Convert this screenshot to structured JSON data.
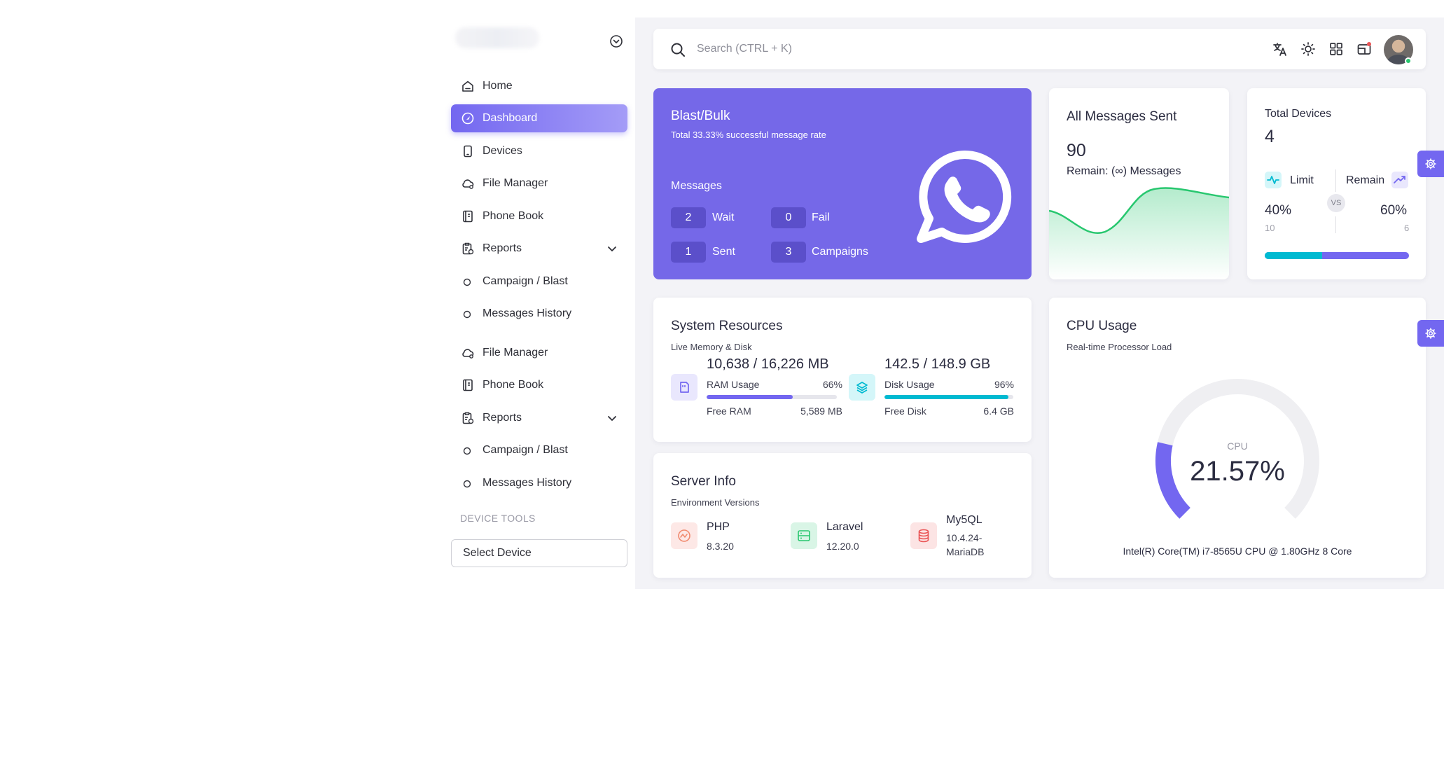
{
  "sidebar": {
    "items": [
      {
        "label": "Home"
      },
      {
        "label": "Dashboard"
      },
      {
        "label": "Devices"
      },
      {
        "label": "File Manager"
      },
      {
        "label": "Phone Book"
      },
      {
        "label": "Reports"
      },
      {
        "label": "Campaign / Blast"
      },
      {
        "label": "Messages History"
      },
      {
        "label": "File Manager"
      },
      {
        "label": "Phone Book"
      },
      {
        "label": "Reports"
      },
      {
        "label": "Campaign / Blast"
      },
      {
        "label": "Messages History"
      }
    ],
    "section_title": "DEVICE TOOLS",
    "select_device": "Select Device"
  },
  "search": {
    "placeholder": "Search (CTRL + K)"
  },
  "blast": {
    "title": "Blast/Bulk",
    "subtitle_prefix": "Total ",
    "rate": "33.33%",
    "subtitle_suffix": " successful message rate",
    "messages_label": "Messages",
    "stats": [
      {
        "value": "2",
        "label": "Wait"
      },
      {
        "value": "0",
        "label": "Fail"
      },
      {
        "value": "1",
        "label": "Sent"
      },
      {
        "value": "3",
        "label": "Campaigns"
      }
    ]
  },
  "all_messages": {
    "title": "All Messages Sent",
    "count": "90",
    "remain": "Remain: (∞) Messages"
  },
  "devices": {
    "title": "Total Devices",
    "count": "4",
    "limit_label": "Limit",
    "remain_label": "Remain",
    "vs": "VS",
    "limit_pct": "40%",
    "remain_pct": "60%",
    "limit_count": "10",
    "remain_count": "6",
    "limit_fraction": 0.4
  },
  "system": {
    "title": "System Resources",
    "subtitle": "Live Memory & Disk",
    "ram": {
      "value": "10,638 / 16,226 MB",
      "label": "RAM Usage",
      "pct": "66%",
      "fraction": 0.66,
      "free_label": "Free RAM",
      "free_value": "5,589 MB"
    },
    "disk": {
      "value": "142.5 / 148.9 GB",
      "label": "Disk Usage",
      "pct": "96%",
      "fraction": 0.96,
      "free_label": "Free Disk",
      "free_value": "6.4 GB"
    }
  },
  "server": {
    "title": "Server Info",
    "subtitle": "Environment Versions",
    "php": {
      "name": "PHP",
      "version": "8.3.20"
    },
    "laravel": {
      "name": "Laravel",
      "version": "12.20.0"
    },
    "mysql": {
      "name": "My5QL",
      "version_line1": "10.4.24-",
      "version_line2": "MariaDB"
    }
  },
  "cpu": {
    "title": "CPU Usage",
    "subtitle": "Real-time Processor Load",
    "label": "CPU",
    "value": "21.57%",
    "fraction": 0.2157,
    "model": "Intel(R) Core(TM) i7-8565U CPU @ 1.80GHz 8 Core"
  },
  "colors": {
    "primary": "#7367f0",
    "blast_bg": "#7568e8",
    "info": "#00bad1",
    "success": "#28c76f",
    "danger": "#ea5455"
  }
}
